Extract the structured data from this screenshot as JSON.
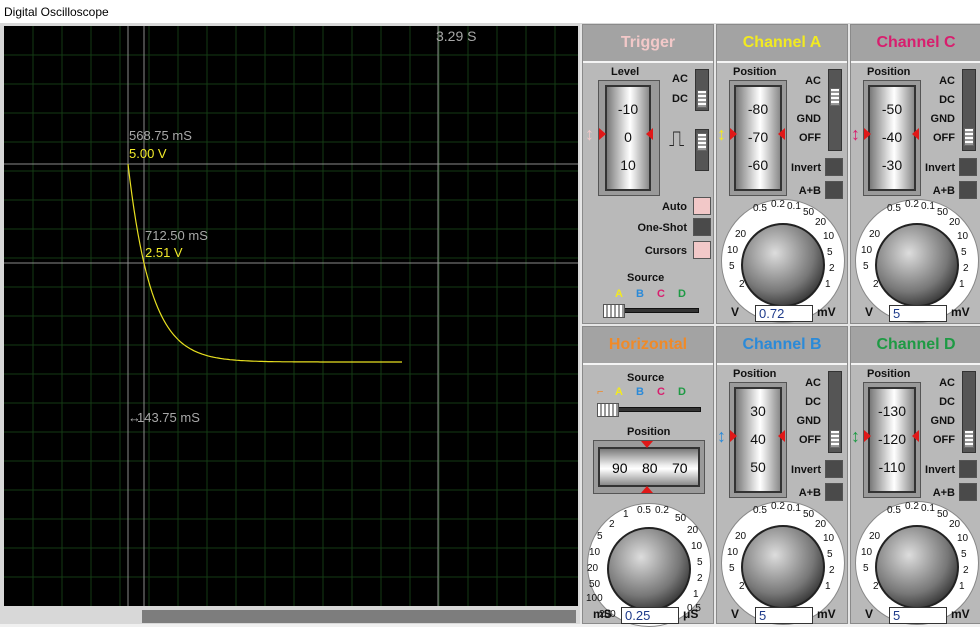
{
  "window": {
    "title": "Digital Oscilloscope"
  },
  "screen": {
    "time_total": "3.29 S",
    "cursors": [
      {
        "time": "568.75 mS",
        "value": "5.00 V"
      },
      {
        "time": "712.50 mS",
        "value": "2.51 V"
      }
    ],
    "delta": "143.75 mS",
    "trace_color": "#e8e020"
  },
  "trigger": {
    "title": "Trigger",
    "level_label": "Level",
    "level_ticks": [
      "-10",
      "0",
      "10"
    ],
    "ac": "AC",
    "dc": "DC",
    "auto": "Auto",
    "one_shot": "One-Shot",
    "cursors": "Cursors",
    "source_label": "Source",
    "sources": [
      "A",
      "B",
      "C",
      "D"
    ]
  },
  "horizontal": {
    "title": "Horizontal",
    "source_label": "Source",
    "sources": [
      "A",
      "B",
      "C",
      "D"
    ],
    "position_label": "Position",
    "position_ticks": [
      "90",
      "80",
      "70"
    ],
    "dial_ticks": [
      "0.5",
      "0.2",
      "0.1",
      "50",
      "20",
      "10",
      "5",
      "2",
      "1",
      "0.5",
      "200",
      "100",
      "50",
      "20",
      "10",
      "5",
      "2",
      "1"
    ],
    "unit_left": "mS",
    "unit_right": "μS",
    "value": "0.25"
  },
  "channels": [
    {
      "id": "A",
      "title": "Channel A",
      "color": "#f2ea20",
      "position_label": "Position",
      "ticks": [
        "-80",
        "-70",
        "-60"
      ],
      "value": "0.72",
      "unit_left": "V",
      "unit_right": "mV",
      "coupling": [
        "AC",
        "DC",
        "GND",
        "OFF"
      ],
      "invert": "Invert",
      "aplusb": "A+B",
      "dial_ticks": [
        "0.5",
        "0.2",
        "0.1",
        "50",
        "20",
        "10",
        "5",
        "2",
        "1",
        "2",
        "5",
        "10",
        "20"
      ]
    },
    {
      "id": "C",
      "title": "Channel C",
      "color": "#d81e6e",
      "position_label": "Position",
      "ticks": [
        "-50",
        "-40",
        "-30"
      ],
      "value": "5",
      "unit_left": "V",
      "unit_right": "mV",
      "coupling": [
        "AC",
        "DC",
        "GND",
        "OFF"
      ],
      "invert": "Invert",
      "aplusb": "A+B",
      "dial_ticks": [
        "0.5",
        "0.2",
        "0.1",
        "50",
        "20",
        "10",
        "5",
        "2",
        "1",
        "2",
        "5",
        "10",
        "20"
      ]
    },
    {
      "id": "B",
      "title": "Channel B",
      "color": "#2b8ad8",
      "position_label": "Position",
      "ticks": [
        "30",
        "40",
        "50"
      ],
      "value": "5",
      "unit_left": "V",
      "unit_right": "mV",
      "coupling": [
        "AC",
        "DC",
        "GND",
        "OFF"
      ],
      "invert": "Invert",
      "aplusb": "A+B",
      "dial_ticks": [
        "0.5",
        "0.2",
        "0.1",
        "50",
        "20",
        "10",
        "5",
        "2",
        "1",
        "2",
        "5",
        "10",
        "20"
      ]
    },
    {
      "id": "D",
      "title": "Channel D",
      "color": "#1e9a44",
      "position_label": "Position",
      "ticks": [
        "-130",
        "-120",
        "-110"
      ],
      "value": "5",
      "unit_left": "V",
      "unit_right": "mV",
      "coupling": [
        "AC",
        "DC",
        "GND",
        "OFF"
      ],
      "invert": "Invert",
      "aplusb": "A+B",
      "dial_ticks": [
        "0.5",
        "0.2",
        "0.1",
        "50",
        "20",
        "10",
        "5",
        "2",
        "1",
        "2",
        "5",
        "10",
        "20"
      ]
    }
  ]
}
